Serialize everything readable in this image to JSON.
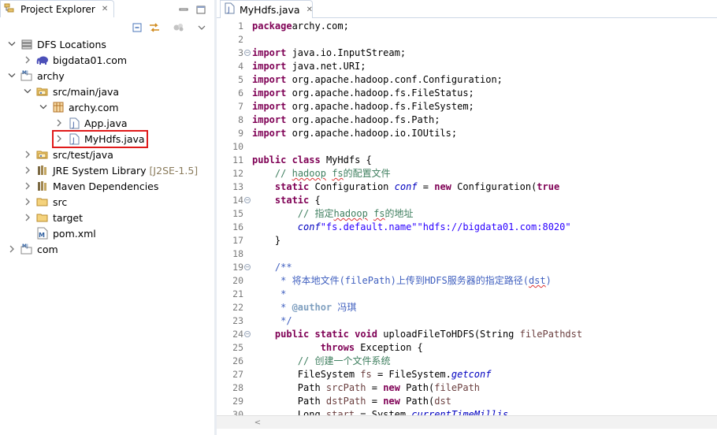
{
  "explorer": {
    "tab_title": "Project Explorer",
    "close_glyph": "✕",
    "tree": [
      {
        "indent": 0,
        "twisty": "expanded",
        "icon": "dfs-locations-icon",
        "label": "DFS Locations"
      },
      {
        "indent": 1,
        "twisty": "collapsed",
        "icon": "elephant-icon",
        "label": "bigdata01.com"
      },
      {
        "indent": 0,
        "twisty": "expanded",
        "icon": "maven-project-icon",
        "label": "archy"
      },
      {
        "indent": 1,
        "twisty": "expanded",
        "icon": "source-folder-icon",
        "label": "src/main/java"
      },
      {
        "indent": 2,
        "twisty": "expanded",
        "icon": "package-icon",
        "label": "archy.com"
      },
      {
        "indent": 3,
        "twisty": "collapsed",
        "icon": "java-file-icon",
        "label": "App.java"
      },
      {
        "indent": 3,
        "twisty": "collapsed",
        "icon": "java-file-icon",
        "label": "MyHdfs.java"
      },
      {
        "indent": 1,
        "twisty": "collapsed",
        "icon": "source-folder-icon",
        "label": "src/test/java"
      },
      {
        "indent": 1,
        "twisty": "collapsed",
        "icon": "library-icon",
        "label": "JRE System Library",
        "decoration": "[J2SE-1.5]"
      },
      {
        "indent": 1,
        "twisty": "collapsed",
        "icon": "library-icon",
        "label": "Maven Dependencies"
      },
      {
        "indent": 1,
        "twisty": "collapsed",
        "icon": "folder-icon",
        "label": "src"
      },
      {
        "indent": 1,
        "twisty": "collapsed",
        "icon": "folder-icon",
        "label": "target"
      },
      {
        "indent": 1,
        "twisty": "none",
        "icon": "xml-file-icon",
        "label": "pom.xml"
      },
      {
        "indent": 0,
        "twisty": "collapsed",
        "icon": "maven-project-icon",
        "label": "com"
      }
    ]
  },
  "editor": {
    "tab_title": "MyHdfs.java",
    "close_glyph": "✕",
    "lines": [
      {
        "n": "1",
        "fold": false,
        "tokens": [
          [
            "kw",
            "package"
          ],
          [
            "",
            "archy.com;"
          ]
        ]
      },
      {
        "n": "2",
        "fold": false,
        "tokens": []
      },
      {
        "n": "3",
        "fold": true,
        "tokens": [
          [
            "kw",
            "import"
          ],
          [
            "",
            " java.io.InputStream;"
          ]
        ]
      },
      {
        "n": "4",
        "fold": false,
        "tokens": [
          [
            "kw",
            "import"
          ],
          [
            "",
            " java.net.URI;"
          ]
        ]
      },
      {
        "n": "5",
        "fold": false,
        "tokens": [
          [
            "kw",
            "import"
          ],
          [
            "",
            " org.apache.hadoop.conf.Configuration;"
          ]
        ]
      },
      {
        "n": "6",
        "fold": false,
        "tokens": [
          [
            "kw",
            "import"
          ],
          [
            "",
            " org.apache.hadoop.fs.FileStatus;"
          ]
        ]
      },
      {
        "n": "7",
        "fold": false,
        "tokens": [
          [
            "kw",
            "import"
          ],
          [
            "",
            " org.apache.hadoop.fs.FileSystem;"
          ]
        ]
      },
      {
        "n": "8",
        "fold": false,
        "tokens": [
          [
            "kw",
            "import"
          ],
          [
            "",
            " org.apache.hadoop.fs.Path;"
          ]
        ]
      },
      {
        "n": "9",
        "fold": false,
        "tokens": [
          [
            "kw",
            "import"
          ],
          [
            "",
            " org.apache.hadoop.io.IOUtils;"
          ]
        ]
      },
      {
        "n": "10",
        "fold": false,
        "tokens": []
      },
      {
        "n": "11",
        "fold": false,
        "tokens": [
          [
            "kw",
            "public"
          ],
          [
            "",
            " "
          ],
          [
            "kw",
            "class"
          ],
          [
            "",
            " MyHdfs {"
          ]
        ]
      },
      {
        "n": "12",
        "fold": false,
        "tokens": [
          [
            "",
            "    "
          ],
          [
            "cm",
            "// "
          ],
          [
            "cm ul",
            "hadoop"
          ],
          [
            "cm",
            " "
          ],
          [
            "cm ul",
            "fs"
          ],
          [
            "cm",
            "的配置文件"
          ]
        ]
      },
      {
        "n": "13",
        "fold": false,
        "tokens": [
          [
            "",
            "    "
          ],
          [
            "kw",
            "static"
          ],
          [
            "",
            " Configuration "
          ],
          [
            "fld",
            "conf"
          ],
          [
            "",
            " = "
          ],
          [
            "kw",
            "new"
          ],
          [
            "",
            " Configuration("
          ],
          [
            "kw",
            "true"
          ],
          [
            ");"
          ]
        ]
      },
      {
        "n": "14",
        "fold": true,
        "tokens": [
          [
            "",
            "    "
          ],
          [
            "kw",
            "static"
          ],
          [
            "",
            " {"
          ]
        ]
      },
      {
        "n": "15",
        "fold": false,
        "tokens": [
          [
            "",
            "        "
          ],
          [
            "cm",
            "// 指定"
          ],
          [
            "cm ul",
            "hadoop"
          ],
          [
            "cm",
            " "
          ],
          [
            "cm ul",
            "fs"
          ],
          [
            "cm",
            "的地址"
          ]
        ]
      },
      {
        "n": "16",
        "fold": false,
        "tokens": [
          [
            "",
            "        "
          ],
          [
            "fld",
            "conf"
          ],
          [
            ".set("
          ],
          [
            "str",
            "\"fs.default.name\""
          ],
          [
            ", "
          ],
          [
            "str",
            "\"hdfs://bigdata01.com:8020\""
          ],
          [
            ");"
          ]
        ]
      },
      {
        "n": "17",
        "fold": false,
        "tokens": [
          [
            "",
            "    }"
          ]
        ]
      },
      {
        "n": "18",
        "fold": false,
        "tokens": []
      },
      {
        "n": "19",
        "fold": true,
        "tokens": [
          [
            "",
            "    "
          ],
          [
            "jd",
            "/**"
          ]
        ]
      },
      {
        "n": "20",
        "fold": false,
        "tokens": [
          [
            "",
            "     "
          ],
          [
            "jd",
            "* 将本地文件(filePath)上传到HDFS服务器的指定路径("
          ],
          [
            "jd ul",
            "dst"
          ],
          [
            "jd",
            ")"
          ]
        ]
      },
      {
        "n": "21",
        "fold": false,
        "tokens": [
          [
            "",
            "     "
          ],
          [
            "jd",
            "*"
          ]
        ]
      },
      {
        "n": "22",
        "fold": false,
        "tokens": [
          [
            "",
            "     "
          ],
          [
            "jd",
            "* "
          ],
          [
            "jt",
            "@author"
          ],
          [
            "jd",
            " 冯琪"
          ]
        ]
      },
      {
        "n": "23",
        "fold": false,
        "tokens": [
          [
            "",
            "     "
          ],
          [
            "jd",
            "*/"
          ]
        ]
      },
      {
        "n": "24",
        "fold": true,
        "tokens": [
          [
            "",
            "    "
          ],
          [
            "kw",
            "public"
          ],
          [
            "",
            " "
          ],
          [
            "kw",
            "static"
          ],
          [
            "",
            " "
          ],
          [
            "kw",
            "void"
          ],
          [
            "",
            " uploadFileToHDFS(String "
          ],
          [
            "lv",
            "filePath"
          ],
          [
            ", String "
          ],
          [
            "lv",
            "dst"
          ],
          [
            ")"
          ]
        ]
      },
      {
        "n": "25",
        "fold": false,
        "tokens": [
          [
            "",
            "            "
          ],
          [
            "kw",
            "throws"
          ],
          [
            "",
            " Exception {"
          ]
        ]
      },
      {
        "n": "26",
        "fold": false,
        "tokens": [
          [
            "",
            "        "
          ],
          [
            "cm",
            "// 创建一个文件系统"
          ]
        ]
      },
      {
        "n": "27",
        "fold": false,
        "tokens": [
          [
            "",
            "        FileSystem "
          ],
          [
            "lv",
            "fs"
          ],
          [
            "",
            " = FileSystem."
          ],
          [
            "fld",
            "get"
          ],
          [
            "("
          ],
          [
            "fld",
            "conf"
          ],
          [
            ");"
          ]
        ]
      },
      {
        "n": "28",
        "fold": false,
        "tokens": [
          [
            "",
            "        Path "
          ],
          [
            "lv",
            "srcPath"
          ],
          [
            "",
            " = "
          ],
          [
            "kw",
            "new"
          ],
          [
            "",
            " Path("
          ],
          [
            "lv",
            "filePath"
          ],
          [
            ");"
          ]
        ]
      },
      {
        "n": "29",
        "fold": false,
        "tokens": [
          [
            "",
            "        Path "
          ],
          [
            "lv",
            "dstPath"
          ],
          [
            "",
            " = "
          ],
          [
            "kw",
            "new"
          ],
          [
            "",
            " Path("
          ],
          [
            "lv",
            "dst"
          ],
          [
            ");"
          ]
        ]
      },
      {
        "n": "30",
        "fold": false,
        "tokens": [
          [
            "",
            "        Long "
          ],
          [
            "lv",
            "start"
          ],
          [
            "",
            " = System."
          ],
          [
            "fld",
            "currentTimeMillis"
          ],
          [
            "();"
          ]
        ]
      }
    ]
  },
  "colors": {
    "keyword": "#7f0055",
    "comment": "#3f7f5f",
    "javadoc": "#3f5fbf",
    "string": "#2a00ff",
    "field": "#0000c0",
    "highlight_box": "#e01a1a"
  }
}
